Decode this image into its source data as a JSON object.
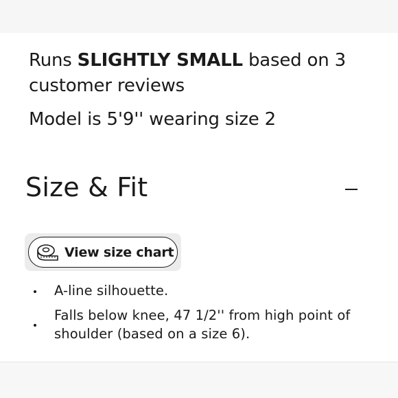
{
  "fit": {
    "prefix": "Runs ",
    "verdict": "SLIGHTLY SMALL",
    "suffix": " based on 3 customer reviews"
  },
  "model_info": "Model is 5'9'' wearing size 2",
  "section": {
    "title": "Size & Fit",
    "toggle_symbol": "minus-icon"
  },
  "size_chart": {
    "label": "View size chart",
    "icon": "measuring-tape-icon"
  },
  "details": [
    "A-line silhouette.",
    "Falls below knee, 47 1/2'' from high point of shoulder (based on a size 6)."
  ]
}
